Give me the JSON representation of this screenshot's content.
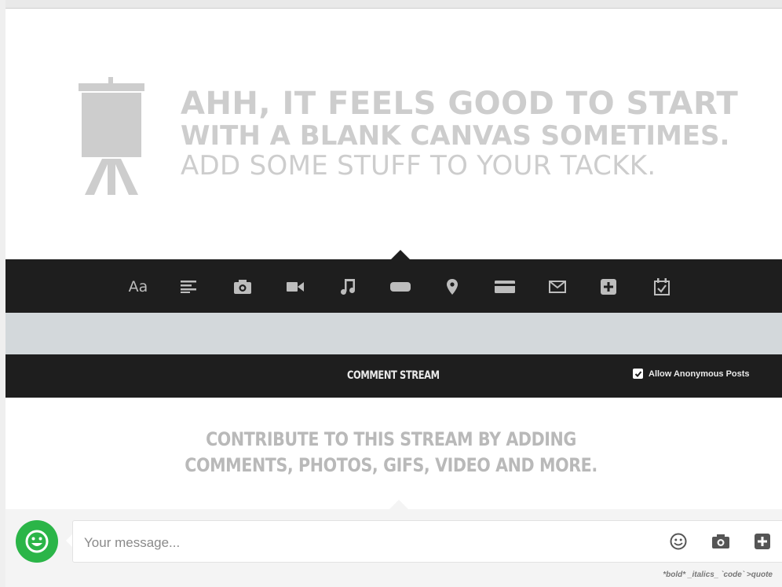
{
  "hero": {
    "line1": "AHH, IT FEELS GOOD TO START",
    "line2": "WITH A BLANK CANVAS SOMETIMES.",
    "line3": "ADD SOME STUFF TO YOUR TACKK."
  },
  "toolbar": {
    "items": [
      {
        "label": "Aa",
        "icon": "text-icon"
      },
      {
        "icon": "paragraph-icon"
      },
      {
        "icon": "camera-icon"
      },
      {
        "icon": "video-icon"
      },
      {
        "icon": "music-icon"
      },
      {
        "icon": "button-icon"
      },
      {
        "icon": "map-pin-icon"
      },
      {
        "icon": "payment-card-icon"
      },
      {
        "icon": "email-icon"
      },
      {
        "icon": "plus-icon"
      },
      {
        "icon": "calendar-check-icon"
      }
    ]
  },
  "stream": {
    "title": "COMMENT STREAM",
    "anonymous_label": "Allow Anonymous Posts",
    "anonymous_checked": true,
    "contribute_line1": "CONTRIBUTE TO THIS STREAM BY ADDING",
    "contribute_line2": "COMMENTS, PHOTOS, GIFS, VIDEO AND MORE."
  },
  "message": {
    "placeholder": "Your message...",
    "format_hint": "*bold* _italics_ `code` >quote"
  },
  "colors": {
    "dark_bar": "#1e1e1e",
    "avatar_green": "#2bb548",
    "hero_text": "#cdcdcd",
    "grey_band": "#d3d8db"
  }
}
